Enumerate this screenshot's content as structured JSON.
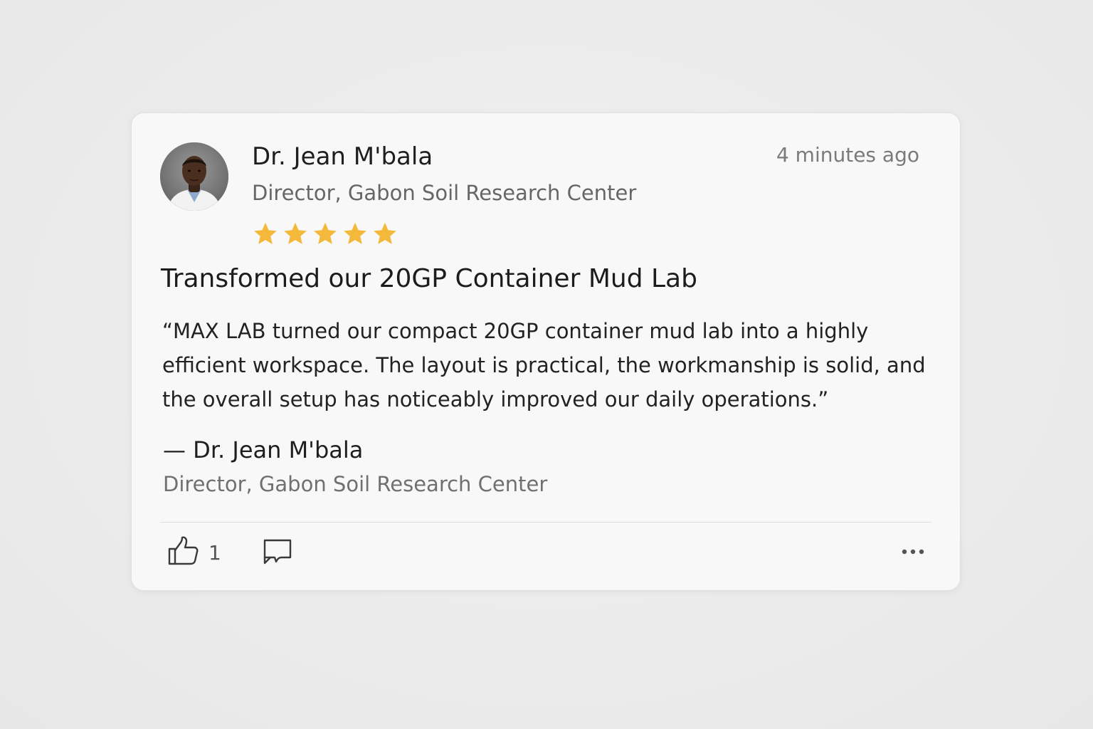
{
  "review": {
    "author": {
      "name": "Dr. Jean M'bala",
      "title": "Director, Gabon Soil Research Center"
    },
    "timestamp": "4 minutes ago",
    "rating": 5,
    "rating_max": 5,
    "title": "Transformed our 20GP Container Mud Lab",
    "quote": "“MAX LAB turned our compact 20GP container mud lab into a highly efficient workspace. The layout is practical, the workmanship is solid, and the overall setup has noticeably improved our daily operations.”",
    "signature": {
      "name": "— Dr. Jean M'bala",
      "title": "Director, Gabon Soil Research Center"
    }
  },
  "actions": {
    "like_count": "1",
    "like_icon": "thumbs-up-icon",
    "comment_icon": "comment-icon",
    "more_icon": "more-horizontal-icon"
  },
  "colors": {
    "star": "#f4b83a",
    "card_background": "#f8f8f8",
    "page_background": "#ebebeb"
  }
}
